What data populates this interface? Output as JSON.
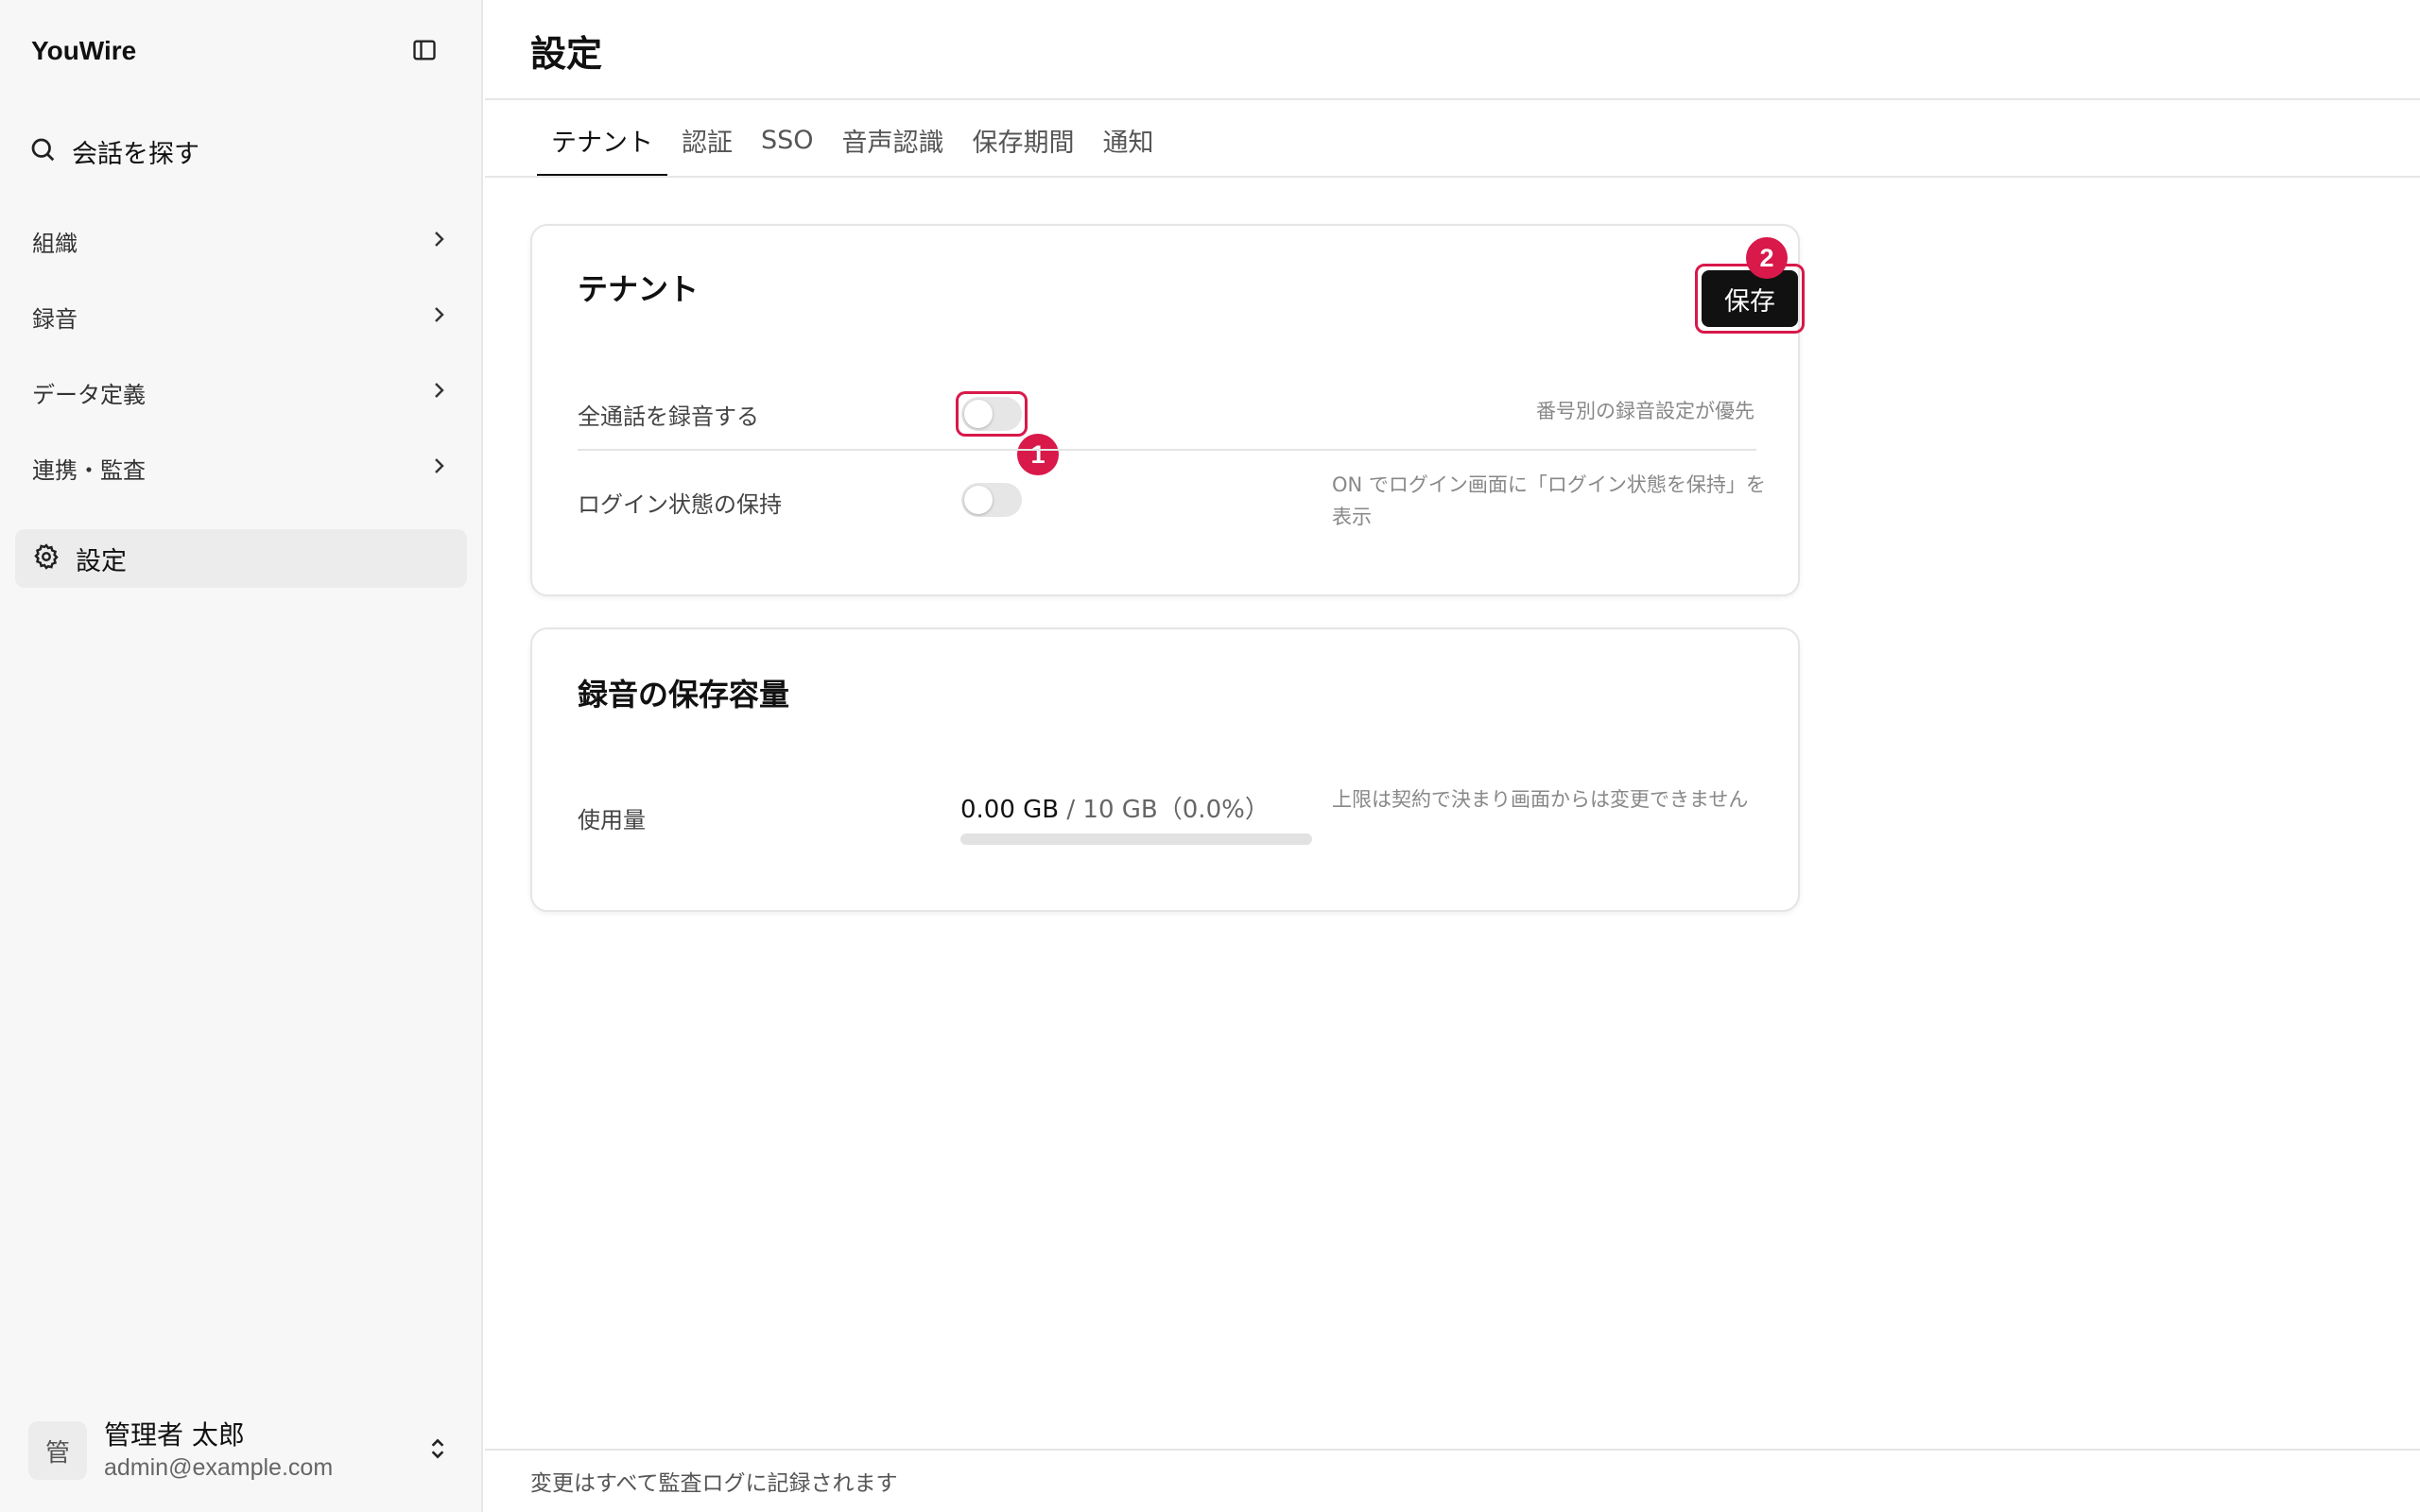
{
  "app": {
    "brand": "YouWire"
  },
  "sidebar": {
    "search_label": "会話を探す",
    "items": [
      {
        "label": "組織"
      },
      {
        "label": "録音"
      },
      {
        "label": "データ定義"
      },
      {
        "label": "連携・監査"
      }
    ],
    "active_item": {
      "label": "設定"
    }
  },
  "user": {
    "avatar_initial": "管",
    "name": "管理者 太郎",
    "email": "admin@example.com"
  },
  "page": {
    "title": "設定"
  },
  "tabs": [
    {
      "label": "テナント",
      "active": true
    },
    {
      "label": "認証"
    },
    {
      "label": "SSO"
    },
    {
      "label": "音声認識"
    },
    {
      "label": "保存期間"
    },
    {
      "label": "通知"
    }
  ],
  "tenant_card": {
    "title": "テナント",
    "save_label": "保存",
    "rows": [
      {
        "label": "全通話を録音する",
        "enabled": false,
        "help": "番号別の録音設定が優先"
      },
      {
        "label": "ログイン状態の保持",
        "enabled": false,
        "help": "ON でログイン画面に「ログイン状態を保持」を表示"
      }
    ]
  },
  "storage_card": {
    "title": "録音の保存容量",
    "row_label": "使用量",
    "used": "0.00 GB",
    "limit": " / 10 GB（0.0%）",
    "usage_fraction": 0.0,
    "help": "上限は契約で決まり画面からは変更できません"
  },
  "annotations": {
    "badge_1": "1",
    "badge_2": "2",
    "accent_color": "#d8194a"
  },
  "footer": {
    "text": "変更はすべて監査ログに記録されます"
  }
}
